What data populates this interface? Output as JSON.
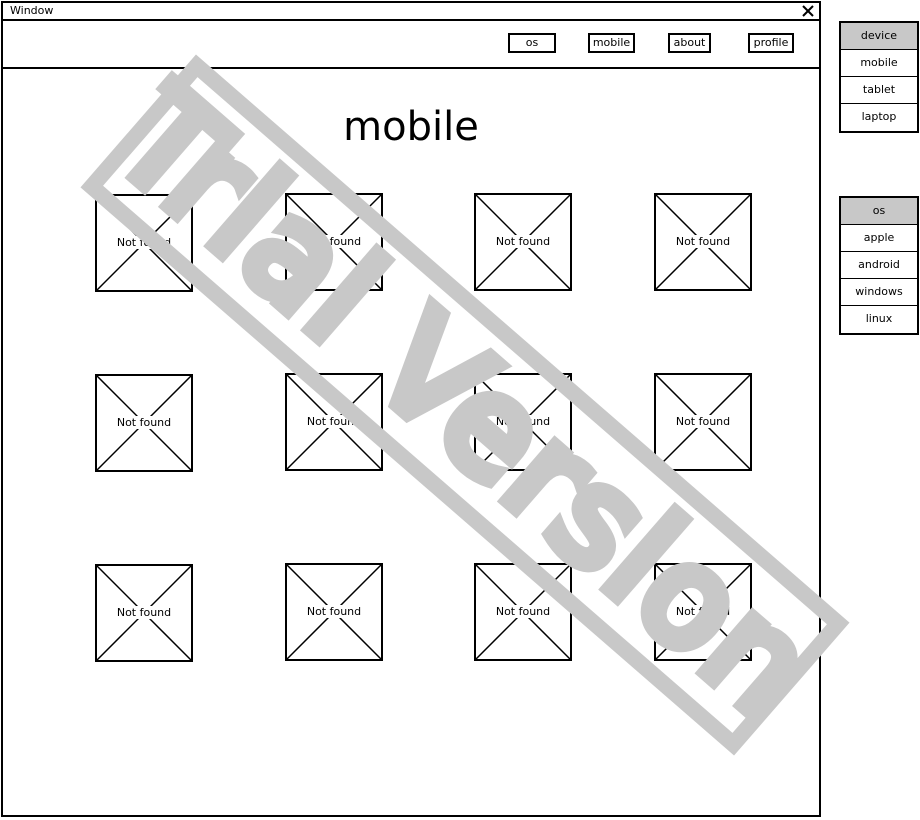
{
  "window": {
    "title": "Window",
    "close_icon": "close-icon"
  },
  "nav": {
    "buttons": [
      {
        "label": "os"
      },
      {
        "label": "mobile"
      },
      {
        "label": "about"
      },
      {
        "label": "profile"
      }
    ]
  },
  "main": {
    "title": "mobile",
    "images": [
      {
        "label": "Not found"
      },
      {
        "label": "Not found"
      },
      {
        "label": "Not found"
      },
      {
        "label": "Not found"
      },
      {
        "label": "Not found"
      },
      {
        "label": "Not found"
      },
      {
        "label": "Not found"
      },
      {
        "label": "Not found"
      },
      {
        "label": "Not found"
      },
      {
        "label": "Not found"
      },
      {
        "label": "Not found"
      },
      {
        "label": "Not found"
      }
    ]
  },
  "device_list": {
    "header": "device",
    "items": [
      "mobile",
      "tablet",
      "laptop"
    ]
  },
  "os_list": {
    "header": "os",
    "items": [
      "apple",
      "android",
      "windows",
      "linux"
    ]
  },
  "watermark": {
    "text": "Trial Version",
    "color": "#c8c8c8"
  }
}
